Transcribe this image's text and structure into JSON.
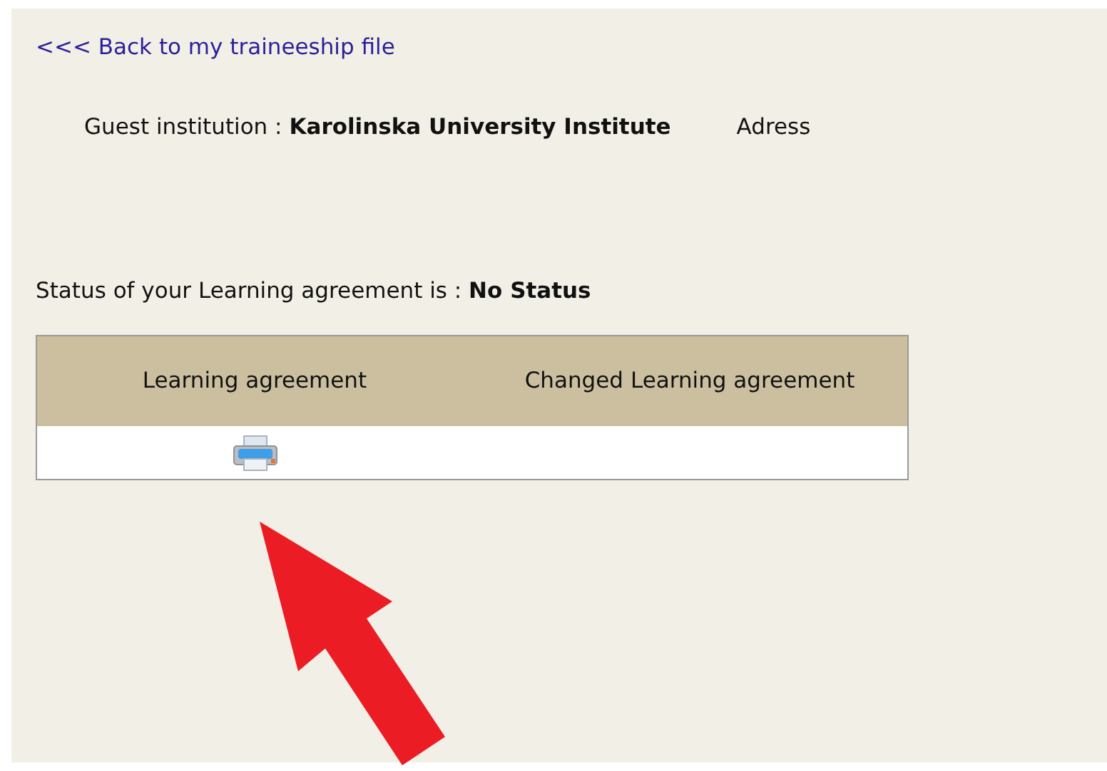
{
  "back_link": "<<< Back to my traineeship file",
  "guest_institution": "Guest institution : **Karolinska University Institute**",
  "address_label": "Adress",
  "status": "Status of your Learning agreement is : **No Status**",
  "table": {
    "columns": [
      "Learning agreement",
      "Changed Learning agreement"
    ],
    "rows": [
      {
        "cells": [
          {
            "kind": "print"
          },
          {
            "kind": "empty"
          }
        ]
      }
    ]
  }
}
